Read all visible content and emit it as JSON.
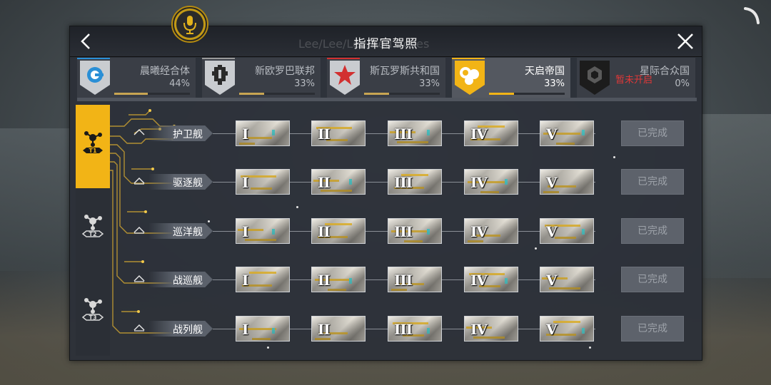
{
  "header": {
    "title": "指挥官驾照",
    "ghost_text": "Lee/Lee/Lee/Red Roses"
  },
  "factions": [
    {
      "name": "晨曦经合体",
      "percent": "44%",
      "progress": 0.44,
      "active": false,
      "color": "#2a8fd6",
      "icon": "ring-logo-icon"
    },
    {
      "name": "新欧罗巴联邦",
      "percent": "33%",
      "progress": 0.33,
      "active": false,
      "color": "#9a9a9a",
      "icon": "cross-logo-icon"
    },
    {
      "name": "斯瓦罗斯共和国",
      "percent": "33%",
      "progress": 0.33,
      "active": false,
      "color": "#d23030",
      "icon": "star-logo-icon"
    },
    {
      "name": "天启帝国",
      "percent": "33%",
      "progress": 0.33,
      "active": true,
      "color": "#f2b416",
      "icon": "orbs-logo-icon"
    },
    {
      "name": "星际合众国",
      "percent": "0%",
      "progress": 0,
      "active": false,
      "locked_label": "暂未开启",
      "color": "#444444",
      "icon": "hex-logo-icon"
    }
  ],
  "tiers": [
    {
      "label": "T1",
      "active": true
    },
    {
      "label": "T2",
      "active": false
    },
    {
      "label": "T3",
      "active": false
    }
  ],
  "ships": [
    {
      "label": "护卫舰",
      "status": "已完成"
    },
    {
      "label": "驱逐舰",
      "status": "已完成"
    },
    {
      "label": "巡洋舰",
      "status": "已完成"
    },
    {
      "label": "战巡舰",
      "status": "已完成"
    },
    {
      "label": "战列舰",
      "status": "已完成"
    }
  ],
  "levels": [
    "I",
    "II",
    "III",
    "IV",
    "V"
  ],
  "colors": {
    "accent": "#f2b416",
    "panel": "#2c3038",
    "locked": "#e03838"
  }
}
